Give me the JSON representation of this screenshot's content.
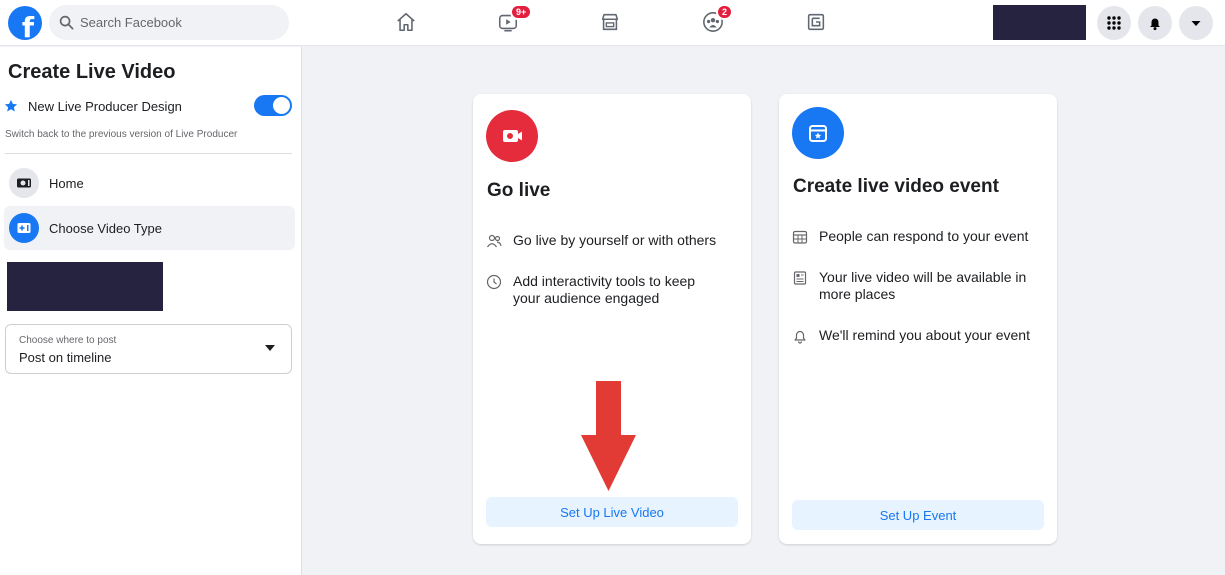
{
  "header": {
    "logo_letter": "f",
    "search_placeholder": "Search Facebook",
    "watch_badge": "9+",
    "groups_badge": "2"
  },
  "sidebar": {
    "title": "Create Live Video",
    "design_label": "New Live Producer Design",
    "design_toggle_on": true,
    "switch_back_text": "Switch back to the previous version of Live Producer",
    "items": [
      {
        "label": "Home"
      },
      {
        "label": "Choose Video Type"
      }
    ],
    "post_select": {
      "label": "Choose where to post",
      "value": "Post on timeline"
    }
  },
  "go_live_card": {
    "title": "Go live",
    "features": [
      {
        "icon": "people-icon",
        "text": "Go live by yourself or with others"
      },
      {
        "icon": "clock-icon",
        "text": "Add interactivity tools to keep your audience engaged"
      }
    ],
    "button_label": "Set Up Live Video"
  },
  "event_card": {
    "title": "Create live video event",
    "features": [
      {
        "icon": "calendar-grid-icon",
        "text": "People can respond to your event"
      },
      {
        "icon": "news-feed-icon",
        "text": "Your live video will be available in more places"
      },
      {
        "icon": "bell-icon",
        "text": "We'll remind you about your event"
      }
    ],
    "button_label": "Set Up Event"
  },
  "colors": {
    "brand_blue": "#1877f2",
    "go_live_red": "#e42c3c",
    "arrow_red": "#e23b36",
    "redaction": "#25233f"
  }
}
